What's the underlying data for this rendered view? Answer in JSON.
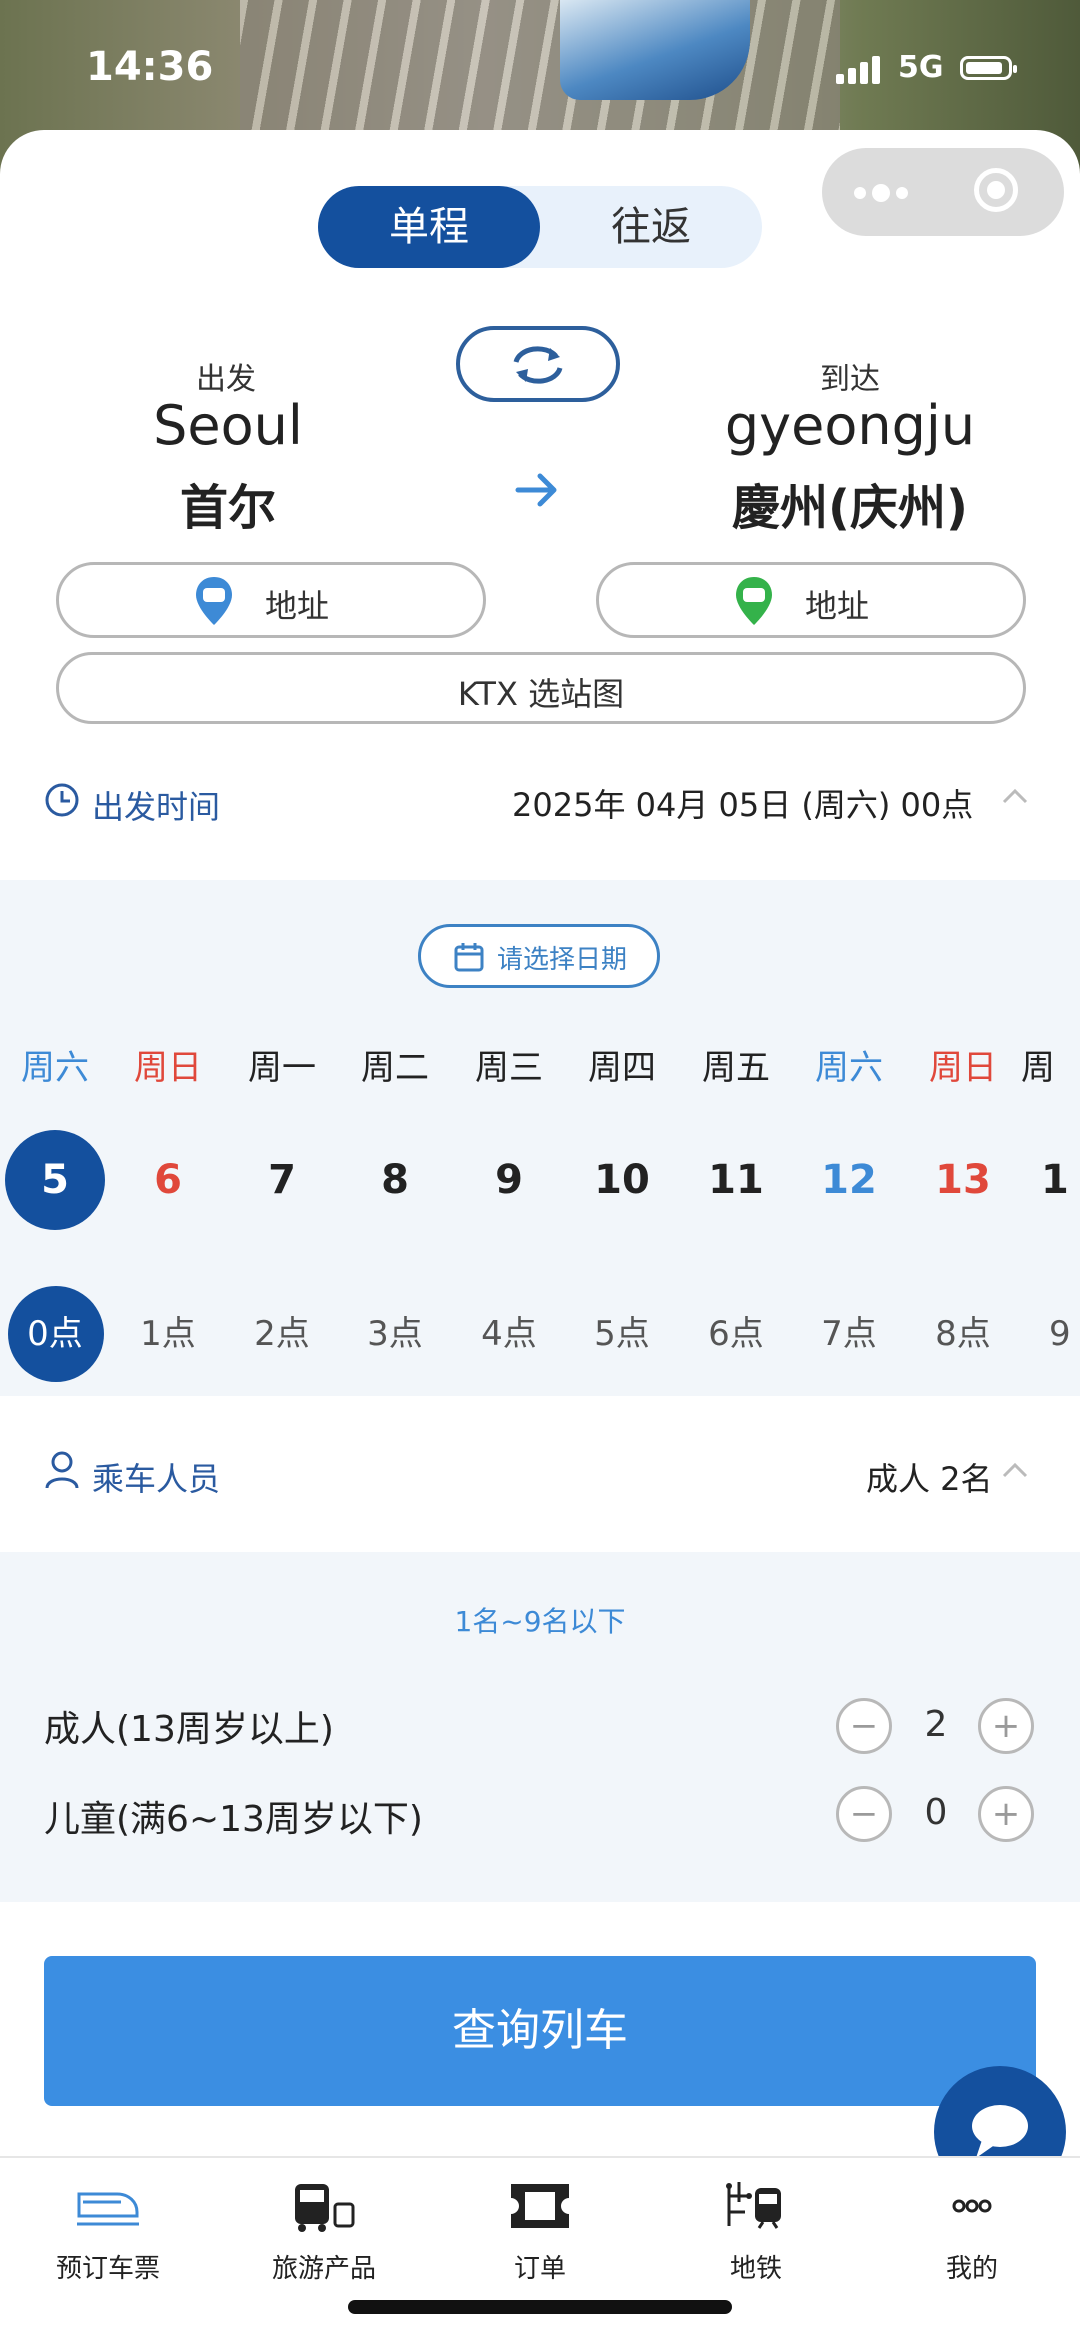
{
  "status_bar": {
    "time": "14:36",
    "network": "5G"
  },
  "trip_type": {
    "one_way": "单程",
    "round_trip": "往返"
  },
  "route": {
    "from_label": "出发",
    "from_en": "Seoul",
    "from_cn": "首尔",
    "to_label": "到达",
    "to_en": "gyeongju",
    "to_cn": "慶州(庆州)",
    "address_label": "地址",
    "ktx_map": "KTX 选站图"
  },
  "departure": {
    "title": "出发时间",
    "value": "2025年 04月 05日 (周六) 00点",
    "choose_date": "请选择日期"
  },
  "calendar": {
    "weekdays": [
      "周六",
      "周日",
      "周一",
      "周二",
      "周三",
      "周四",
      "周五",
      "周六",
      "周日",
      "周"
    ],
    "days": [
      "5",
      "6",
      "7",
      "8",
      "9",
      "10",
      "11",
      "12",
      "13",
      "1"
    ],
    "hours": [
      "0点",
      "1点",
      "2点",
      "3点",
      "4点",
      "5点",
      "6点",
      "7点",
      "8点",
      "9"
    ]
  },
  "passengers": {
    "title": "乘车人员",
    "value": "成人 2名",
    "note": "1名~9名以下",
    "adult_label": "成人(13周岁以上)",
    "adult_count": "2",
    "child_label": "儿童(满6~13周岁以下)",
    "child_count": "0",
    "minus": "−",
    "plus": "+"
  },
  "search_button": "查询列车",
  "tabs": [
    "预订车票",
    "旅游产品",
    "订单",
    "地铁",
    "我的"
  ],
  "colors": {
    "primary": "#14509e",
    "accent": "#3b8ee2",
    "sunday": "#e0483b",
    "saturday": "#3d8ad6"
  }
}
